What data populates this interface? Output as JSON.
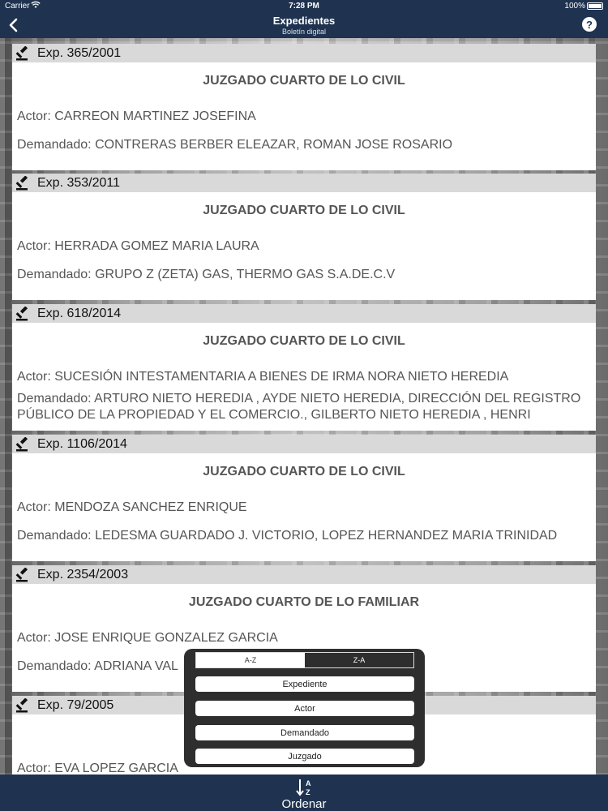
{
  "status_bar": {
    "carrier": "Carrier",
    "time": "7:28 PM",
    "battery": "100%"
  },
  "nav": {
    "title": "Expedientes",
    "subtitle": "Boletín digital",
    "help": "?"
  },
  "cards": [
    {
      "exp": "Exp. 365/2001",
      "juzgado": "JUZGADO CUARTO DE LO CIVIL",
      "actor": "Actor: CARREON MARTINEZ JOSEFINA",
      "demandado": "Demandado: CONTRERAS BERBER ELEAZAR, ROMAN JOSE ROSARIO"
    },
    {
      "exp": "Exp. 353/2011",
      "juzgado": "JUZGADO CUARTO DE LO CIVIL",
      "actor": "Actor: HERRADA GOMEZ MARIA LAURA",
      "demandado": "Demandado: GRUPO Z (ZETA) GAS, THERMO GAS S.A.DE.C.V"
    },
    {
      "exp": "Exp. 618/2014",
      "juzgado": "JUZGADO CUARTO DE LO CIVIL",
      "actor": "Actor: SUCESIÓN INTESTAMENTARIA A BIENES DE IRMA NORA NIETO HEREDIA",
      "demandado": "Demandado: ARTURO NIETO HEREDIA , AYDE NIETO HEREDIA, DIRECCIÓN DEL REGISTRO PÚBLICO DE LA PROPIEDAD Y EL COMERCIO., GILBERTO NIETO HEREDIA , HENRI ROUYER..."
    },
    {
      "exp": "Exp. 1106/2014",
      "juzgado": "JUZGADO CUARTO DE LO CIVIL",
      "actor": "Actor: MENDOZA SANCHEZ ENRIQUE",
      "demandado": "Demandado: LEDESMA GUARDADO J. VICTORIO, LOPEZ HERNANDEZ MARIA TRINIDAD"
    },
    {
      "exp": "Exp. 2354/2003",
      "juzgado": "JUZGADO CUARTO DE LO FAMILIAR",
      "actor": "Actor: JOSE ENRIQUE GONZALEZ GARCIA",
      "demandado": "Demandado: ADRIANA VAL"
    },
    {
      "exp": "Exp. 79/2005",
      "juzgado": "",
      "actor": "Actor: EVA LOPEZ GARCIA",
      "demandado": ""
    }
  ],
  "sort_popup": {
    "order_asc": "A-Z",
    "order_desc": "Z-A",
    "selected_order": "Z-A",
    "options": [
      "Expediente",
      "Actor",
      "Demandado",
      "Juzgado"
    ]
  },
  "bottom_bar": {
    "sort_label": "Ordenar",
    "sort_icon_top": "A",
    "sort_icon_bottom": "Z"
  },
  "colors": {
    "bar": "#1f3350",
    "card_header": "#d9d9d9",
    "popup": "#2e2e2e"
  }
}
